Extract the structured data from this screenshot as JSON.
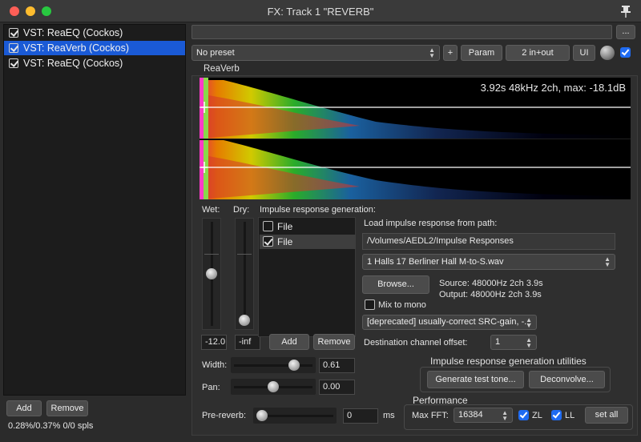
{
  "window": {
    "title": "FX: Track 1 \"REVERB\""
  },
  "fx_chain": {
    "items": [
      {
        "label": "VST: ReaEQ (Cockos)",
        "enabled": true,
        "selected": false
      },
      {
        "label": "VST: ReaVerb (Cockos)",
        "enabled": true,
        "selected": true
      },
      {
        "label": "VST: ReaEQ (Cockos)",
        "enabled": true,
        "selected": false
      }
    ],
    "add_label": "Add",
    "remove_label": "Remove",
    "cpu_text": "0.28%/0.37% 0/0 spls"
  },
  "toolbar": {
    "more_label": "...",
    "preset_value": "No preset",
    "plus_label": "+",
    "param_label": "Param",
    "io_label": "2 in+out",
    "ui_label": "UI"
  },
  "plugin": {
    "name": "ReaVerb",
    "ir_info": "3.92s 48kHz 2ch, max: -18.1dB"
  },
  "controls": {
    "wet_label": "Wet:",
    "dry_label": "Dry:",
    "wet_value": "-12.0",
    "dry_value": "-inf",
    "wet_level": 0.5,
    "dry_level": 0.0,
    "ir_gen_label": "Impulse response generation:",
    "ir_gen_items": [
      {
        "label": "File",
        "checked": false
      },
      {
        "label": "File",
        "checked": true
      }
    ],
    "add_label": "Add",
    "remove_label": "Remove",
    "width_label": "Width:",
    "width_value": "0.61",
    "width_level": 0.805,
    "pan_label": "Pan:",
    "pan_value": "0.00",
    "pan_level": 0.5,
    "prereverb_label": "Pre-reverb:",
    "prereverb_value": "0",
    "prereverb_unit": "ms",
    "prereverb_level": 0.0
  },
  "file_panel": {
    "load_label": "Load impulse response from path:",
    "path_value": "/Volumes/AEDL2/Impulse Responses",
    "file_value": "1 Halls 17 Berliner Hall  M-to-S.wav",
    "browse_label": "Browse...",
    "source_text": "Source: 48000Hz 2ch 3.9s",
    "output_text": "Output: 48000Hz 2ch 3.9s",
    "mix_mono_label": "Mix to mono",
    "mix_mono_checked": false,
    "src_mode_value": "[deprecated] usually-correct SRC-gain, -...",
    "dest_offset_label": "Destination channel offset:",
    "dest_offset_value": "1"
  },
  "utilities": {
    "title": "Impulse response generation utilities",
    "test_tone_label": "Generate test tone...",
    "deconvolve_label": "Deconvolve..."
  },
  "performance": {
    "title": "Performance",
    "max_fft_label": "Max FFT:",
    "max_fft_value": "16384",
    "zl_label": "ZL",
    "zl_checked": true,
    "ll_label": "LL",
    "ll_checked": true,
    "set_all_label": "set all"
  }
}
